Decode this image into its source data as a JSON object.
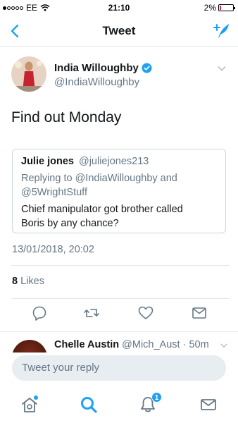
{
  "status": {
    "carrier": "EE",
    "time": "21:10",
    "battery": "2%"
  },
  "nav": {
    "title": "Tweet"
  },
  "tweet": {
    "author_name": "India Willoughby",
    "author_handle": "@IndiaWilloughby",
    "text": "Find out Monday",
    "timestamp": "13/01/2018, 20:02",
    "likes_count": "8",
    "likes_label": "Likes"
  },
  "quote": {
    "name": "Julie jones",
    "handle": "@juliejones213",
    "replying_line1": "Replying to @IndiaWilloughby and",
    "replying_line2": "@5WrightStuff",
    "text_line1": "Chief manipulator got brother called",
    "text_line2": "Boris by any chance?"
  },
  "reply": {
    "name": "Chelle Austin",
    "handle_time": "@Mich_Aust · 50m"
  },
  "composer": {
    "placeholder": "Tweet your reply"
  },
  "tabs": {
    "notifications_badge": "1"
  },
  "colors": {
    "accent": "#1da1f2",
    "secondary_text": "#657786",
    "divider": "#e1e8ed"
  }
}
